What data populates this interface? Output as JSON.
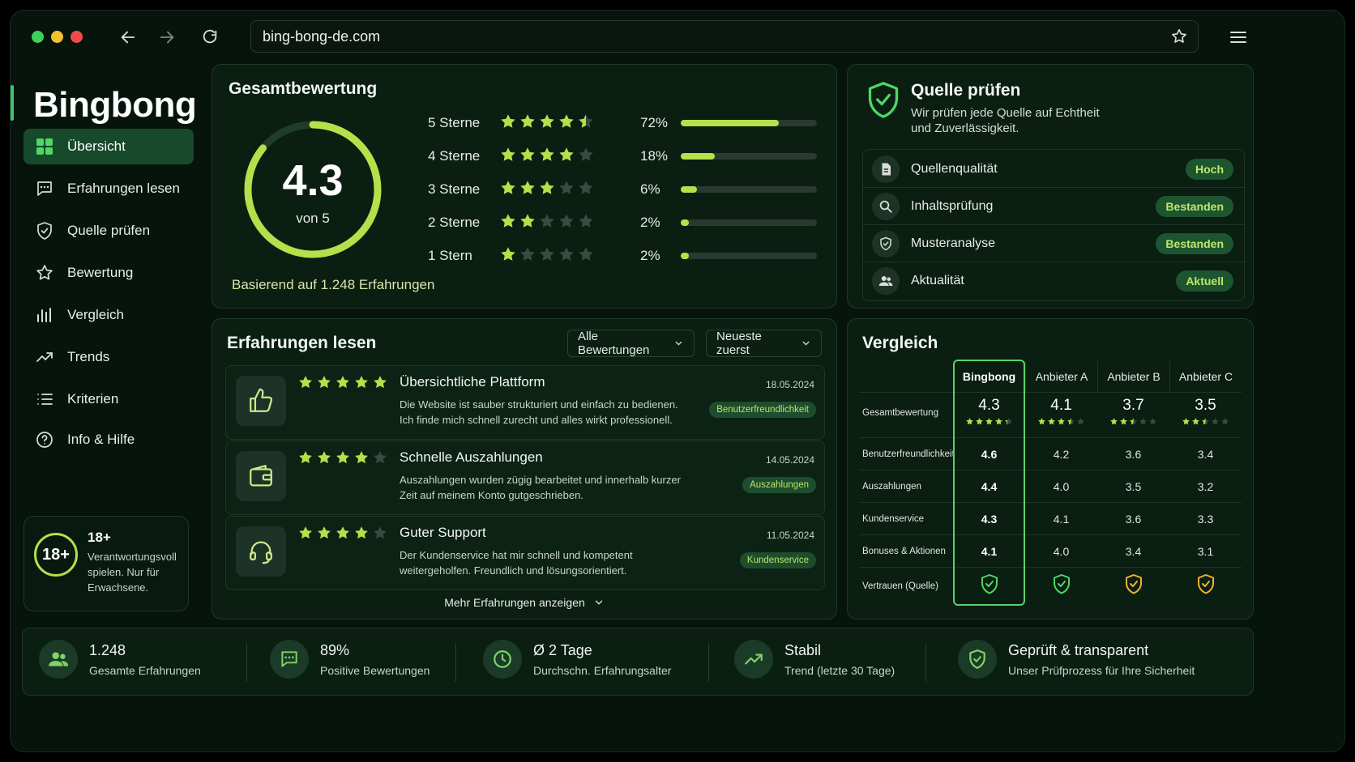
{
  "browser": {
    "url": "bing-bong-de.com"
  },
  "sidebar": {
    "logo": "Bingbong",
    "items": [
      {
        "label": "Übersicht",
        "icon": "grid-icon"
      },
      {
        "label": "Erfahrungen lesen",
        "icon": "chat-icon"
      },
      {
        "label": "Quelle prüfen",
        "icon": "shield-icon"
      },
      {
        "label": "Bewertung",
        "icon": "star-icon"
      },
      {
        "label": "Vergleich",
        "icon": "bar-chart-icon"
      },
      {
        "label": "Trends",
        "icon": "trend-icon"
      },
      {
        "label": "Kriterien",
        "icon": "list-icon"
      },
      {
        "label": "Info & Hilfe",
        "icon": "help-icon"
      }
    ],
    "age": {
      "badge": "18+",
      "title": "18+",
      "text": "Verantwortungsvoll spielen. Nur für Erwachsene."
    }
  },
  "rating": {
    "title": "Gesamtbewertung",
    "score": "4.3",
    "score_fraction": 0.86,
    "of": "von 5",
    "based_on": "Basierend auf 1.248 Erfahrungen",
    "rows": [
      {
        "label": "5 Sterne",
        "stars": 4.5,
        "pct": "72%",
        "fill": 0.72
      },
      {
        "label": "4 Sterne",
        "stars": 4,
        "pct": "18%",
        "fill": 0.25
      },
      {
        "label": "3 Sterne",
        "stars": 3,
        "pct": "6%",
        "fill": 0.12
      },
      {
        "label": "2 Sterne",
        "stars": 2,
        "pct": "2%",
        "fill": 0.06
      },
      {
        "label": "1 Stern",
        "stars": 1,
        "pct": "2%",
        "fill": 0.06
      }
    ]
  },
  "source": {
    "title": "Quelle prüfen",
    "subtitle": "Wir prüfen jede Quelle auf Echtheit und Zuverlässigkeit.",
    "items": [
      {
        "label": "Quellenqualität",
        "status": "Hoch",
        "icon": "document-icon"
      },
      {
        "label": "Inhaltsprüfung",
        "status": "Bestanden",
        "icon": "search-icon"
      },
      {
        "label": "Musteranalyse",
        "status": "Bestanden",
        "icon": "shield-check-icon"
      },
      {
        "label": "Aktualität",
        "status": "Aktuell",
        "icon": "users-icon"
      }
    ]
  },
  "reviews": {
    "title": "Erfahrungen lesen",
    "filter": "Alle Bewertungen",
    "sort": "Neueste zuerst",
    "more": "Mehr Erfahrungen anzeigen",
    "items": [
      {
        "title": "Übersichtliche Plattform",
        "date": "18.05.2024",
        "stars": 5,
        "text": "Die Website ist sauber strukturiert und einfach zu bedienen. Ich finde mich schnell zurecht und alles wirkt professionell.",
        "tag": "Benutzerfreundlichkeit",
        "icon": "thumbs-up-icon"
      },
      {
        "title": "Schnelle Auszahlungen",
        "date": "14.05.2024",
        "stars": 4,
        "text": "Auszahlungen wurden zügig bearbeitet und innerhalb kurzer Zeit auf meinem Konto gutgeschrieben.",
        "tag": "Auszahlungen",
        "icon": "wallet-icon"
      },
      {
        "title": "Guter Support",
        "date": "11.05.2024",
        "stars": 4,
        "text": "Der Kundenservice hat mir schnell und kompetent weitergeholfen. Freundlich und lösungsorientiert.",
        "tag": "Kundenservice",
        "icon": "headset-icon"
      }
    ]
  },
  "comparison": {
    "title": "Vergleich",
    "columns": [
      "Bingbong",
      "Anbieter A",
      "Anbieter B",
      "Anbieter C"
    ],
    "overall_label": "Gesamtbewertung",
    "overall": [
      "4.3",
      "4.1",
      "3.7",
      "3.5"
    ],
    "overall_stars": [
      4.3,
      3.5,
      2.5,
      2.5
    ],
    "rows": [
      {
        "label": "Benutzerfreundlichkeit",
        "values": [
          "4.6",
          "4.2",
          "3.6",
          "3.4"
        ]
      },
      {
        "label": "Auszahlungen",
        "values": [
          "4.4",
          "4.0",
          "3.5",
          "3.2"
        ]
      },
      {
        "label": "Kundenservice",
        "values": [
          "4.3",
          "4.1",
          "3.6",
          "3.3"
        ]
      },
      {
        "label": "Bonuses & Aktionen",
        "values": [
          "4.1",
          "4.0",
          "3.4",
          "3.1"
        ]
      }
    ],
    "trust_label": "Vertrauen (Quelle)",
    "trust_colors": [
      "#4cd964",
      "#4cd964",
      "#f2b233",
      "#f2b233"
    ]
  },
  "footer": {
    "stats": [
      {
        "value": "1.248",
        "label": "Gesamte Erfahrungen",
        "icon": "users-icon"
      },
      {
        "value": "89%",
        "label": "Positive Bewertungen",
        "icon": "chat-icon"
      },
      {
        "value": "Ø 2 Tage",
        "label": "Durchschn. Erfahrungsalter",
        "icon": "clock-icon"
      },
      {
        "value": "Stabil",
        "label": "Trend (letzte 30 Tage)",
        "icon": "trend-icon"
      },
      {
        "value": "Geprüft & transparent",
        "label": "Unser Prüfprozess für Ihre Sicherheit",
        "icon": "shield-check-icon"
      }
    ]
  },
  "colors": {
    "accent": "#b6e04a",
    "green": "#4cd964",
    "gold": "#f2b233"
  }
}
